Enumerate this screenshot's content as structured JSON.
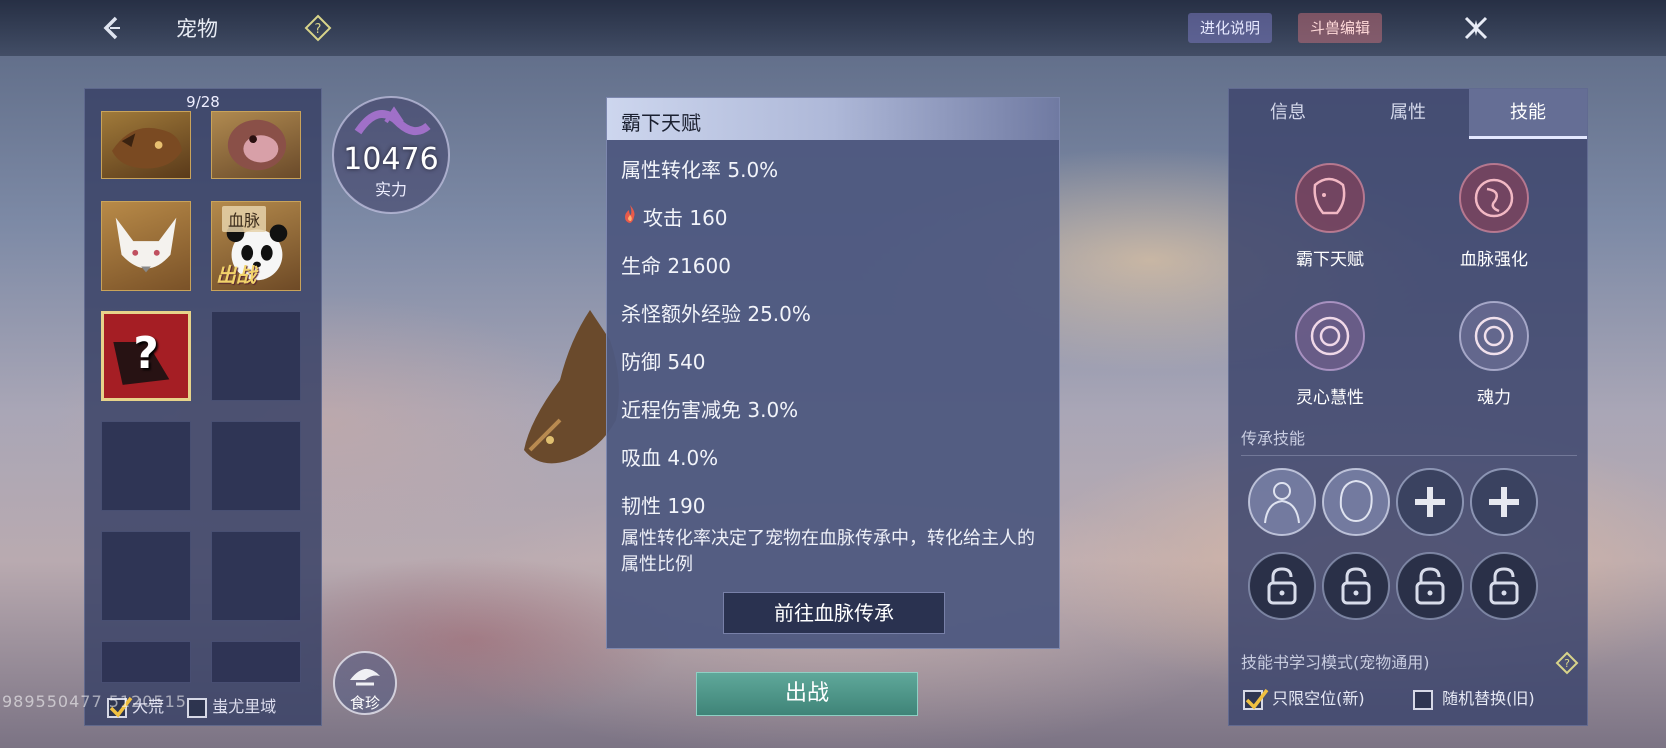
{
  "header": {
    "title": "宠物",
    "evolution_label": "进化说明",
    "edit_label": "斗兽编辑"
  },
  "pets": {
    "count": "9/28",
    "blood_tag": "血脉",
    "fight_tag": "出战",
    "unknown_mark": "?",
    "filters": [
      {
        "label": "大荒",
        "checked": true
      },
      {
        "label": "蚩尤里域",
        "checked": false
      }
    ]
  },
  "power": {
    "value": "10476",
    "label": "实力"
  },
  "food": {
    "label": "食珍"
  },
  "watermark": "989550477 5120515",
  "tooltip": {
    "title": "霸下天赋",
    "rows": [
      {
        "text": "属性转化率 5.0%",
        "icon": ""
      },
      {
        "text": "攻击 160",
        "icon": "fire-icon"
      },
      {
        "text": "生命 21600",
        "icon": ""
      },
      {
        "text": "杀怪额外经验 25.0%",
        "icon": ""
      },
      {
        "text": "防御 540",
        "icon": ""
      },
      {
        "text": "近程伤害减免 3.0%",
        "icon": ""
      },
      {
        "text": "吸血 4.0%",
        "icon": ""
      },
      {
        "text": "韧性 190",
        "icon": ""
      }
    ],
    "description": "属性转化率决定了宠物在血脉传承中，转化给主人的属性比例",
    "goto_label": "前往血脉传承"
  },
  "deploy_label": "出战",
  "info_panel": {
    "tabs": [
      "信息",
      "属性",
      "技能"
    ],
    "active_tab": "技能",
    "skills": [
      "霸下天赋",
      "血脉强化",
      "灵心慧性",
      "魂力"
    ],
    "inherit_label": "传承技能",
    "mode_label": "技能书学习模式(宠物通用)",
    "options": [
      {
        "label": "只限空位(新)",
        "checked": true
      },
      {
        "label": "随机替换(旧)",
        "checked": false
      }
    ]
  },
  "colors": {
    "accent": "#e4e8ff",
    "deploy": "#4f978a",
    "unknown_slot": "#a51e24",
    "border_gold": "#c9a35a"
  }
}
